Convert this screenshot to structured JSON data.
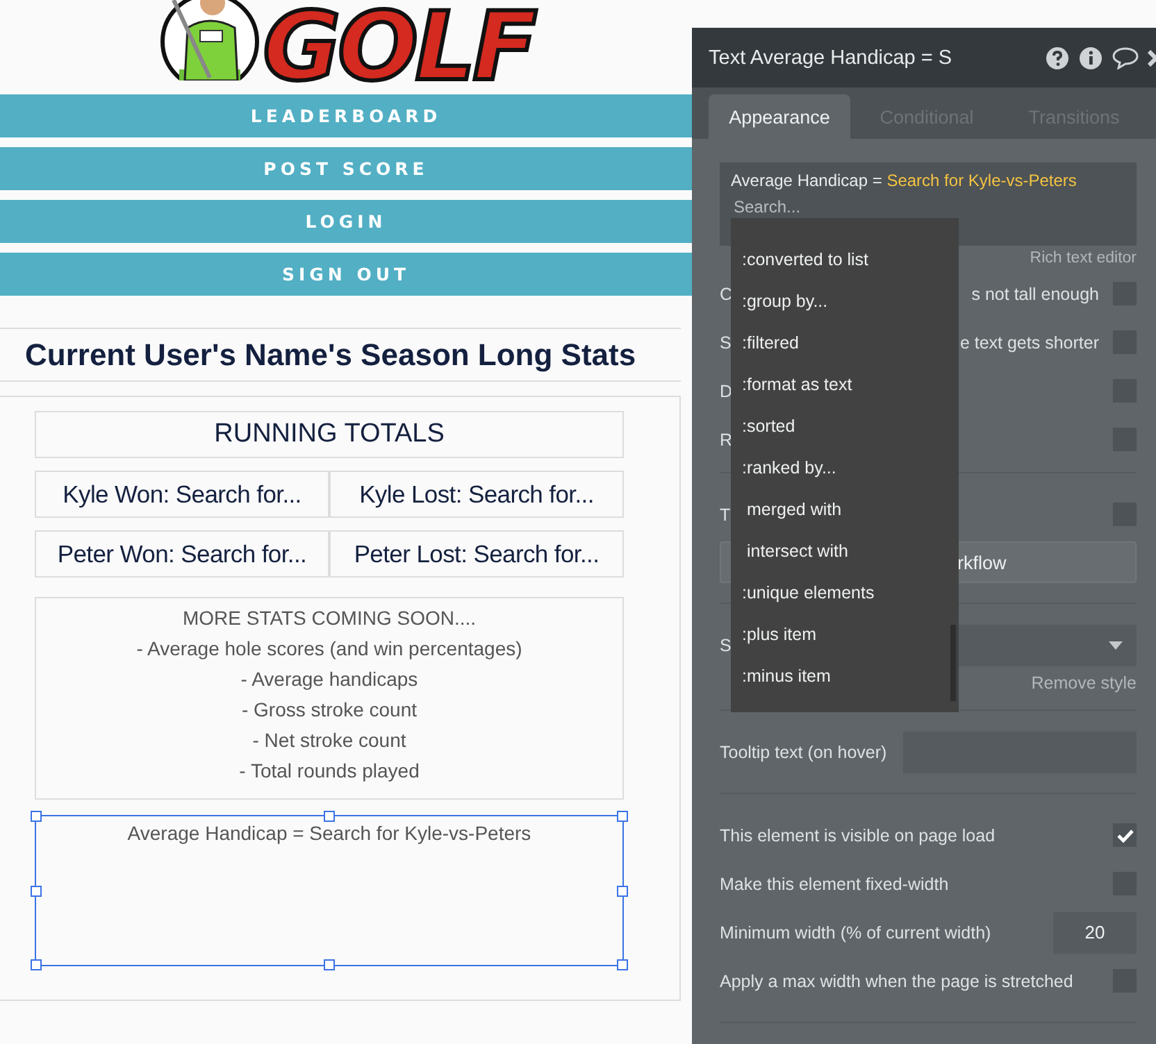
{
  "logo": {
    "wordmark": "GOLF"
  },
  "nav": [
    {
      "label": "LEADERBOARD"
    },
    {
      "label": "POST SCORE"
    },
    {
      "label": "LOGIN"
    },
    {
      "label": "SIGN OUT"
    }
  ],
  "heading": "Current User's Name's Season Long Stats",
  "running_totals": {
    "title": "RUNNING TOTALS",
    "rows": [
      [
        "Kyle Won: Search for...",
        "Kyle Lost: Search for..."
      ],
      [
        "Peter Won: Search for...",
        "Peter Lost: Search for..."
      ]
    ]
  },
  "more_stats": [
    "MORE STATS COMING SOON....",
    "- Average hole scores (and win percentages)",
    "- Average handicaps",
    "- Gross stroke count",
    "- Net stroke count",
    "- Total rounds played"
  ],
  "selected_text": {
    "text": "Average Handicap = Search for Kyle-vs-Peters",
    "selected": true
  },
  "panel": {
    "title": "Text Average Handicap = S",
    "tabs": [
      {
        "label": "Appearance",
        "selected": true
      },
      {
        "label": "Conditional",
        "selected": false
      },
      {
        "label": "Transitions",
        "selected": false
      }
    ],
    "expression": {
      "static": "Average Handicap = ",
      "dynamic": "Search for Kyle-vs-Peters"
    },
    "search": {
      "placeholder": "Search..."
    },
    "rich_text_link": "Rich text editor",
    "sections": [
      {
        "rows": [
          {
            "kind": "checkbox",
            "label_start": "C",
            "label_end": "s not tall enough",
            "checked": false
          },
          {
            "kind": "checkbox",
            "label_start": "S",
            "label_end": "e text gets shorter",
            "checked": false
          },
          {
            "kind": "checkbox",
            "label_start": "D",
            "checked": false
          },
          {
            "kind": "checkbox",
            "label_start": "R",
            "checked": false
          }
        ]
      },
      {
        "rows": [
          {
            "kind": "checkbox",
            "label_start": "T",
            "checked": false
          },
          {
            "kind": "button",
            "label_end": "rkflow"
          }
        ]
      },
      {
        "rows": [
          {
            "kind": "select",
            "label_start": "S",
            "link": "Remove style"
          }
        ]
      },
      {
        "rows": [
          {
            "kind": "text-field",
            "label_start": "Tooltip text (on hover)"
          }
        ]
      },
      {
        "rows": [
          {
            "kind": "checkbox",
            "label_start": "This element is visible on page load",
            "checked": true
          },
          {
            "kind": "checkbox",
            "label_start": "Make this element fixed-width",
            "checked": false
          },
          {
            "kind": "number-field",
            "label_start": "Minimum width (% of current width)",
            "value": "20"
          },
          {
            "kind": "checkbox",
            "label_start": "Apply a max width when the page is stretched",
            "checked": false
          }
        ]
      }
    ],
    "dropdown": {
      "items": [
        ":converted to list",
        ":group by...",
        ":filtered",
        ":format as text",
        ":sorted",
        ":ranked by...",
        " merged with",
        " intersect with",
        ":unique elements",
        ":plus item",
        ":minus item"
      ]
    }
  }
}
